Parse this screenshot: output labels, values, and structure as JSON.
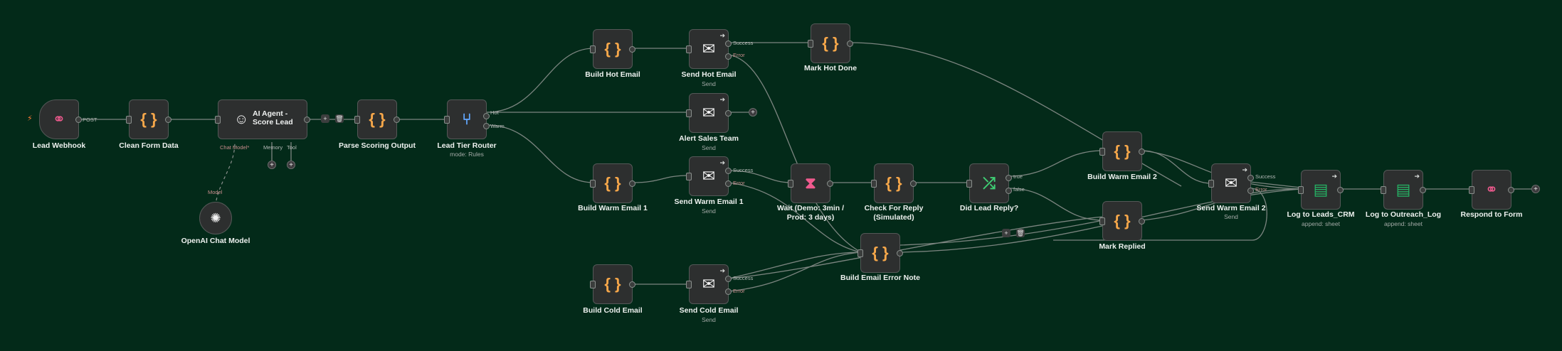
{
  "nodes": {
    "lead_webhook": {
      "label": "Lead Webhook",
      "icon": "webhook-icon",
      "port_label": "POST"
    },
    "clean_form_data": {
      "label": "Clean Form Data",
      "icon": "code-braces-icon"
    },
    "ai_agent": {
      "label": "AI Agent - Score Lead",
      "icon": "robot-icon",
      "port_chat_model": "Chat Model*",
      "port_memory": "Memory",
      "port_tool": "Tool"
    },
    "openai_chat_model": {
      "label": "OpenAI Chat Model",
      "icon": "openai-icon",
      "port_label": "Model"
    },
    "parse_scoring_output": {
      "label": "Parse Scoring Output",
      "icon": "code-braces-icon"
    },
    "lead_tier_router": {
      "label": "Lead Tier Router",
      "sub": "mode: Rules",
      "icon": "router-icon",
      "out_hot": "Hot",
      "out_warm": "Warm"
    },
    "build_hot_email": {
      "label": "Build Hot Email",
      "icon": "code-braces-icon"
    },
    "send_hot_email": {
      "label": "Send Hot Email",
      "sub": "Send",
      "icon": "mail-icon",
      "out_success": "Success",
      "out_error": "Error"
    },
    "mark_hot_done": {
      "label": "Mark Hot Done",
      "icon": "code-braces-icon"
    },
    "alert_sales_team": {
      "label": "Alert Sales Team",
      "sub": "Send",
      "icon": "mail-icon"
    },
    "build_warm_email_1": {
      "label": "Build Warm Email 1",
      "icon": "code-braces-icon"
    },
    "send_warm_email_1": {
      "label": "Send Warm Email 1",
      "sub": "Send",
      "icon": "mail-icon",
      "out_success": "Success",
      "out_error": "Error"
    },
    "wait": {
      "label": "Wait (Demo: 3min / Prod: 3 days)",
      "icon": "hourglass-icon"
    },
    "check_for_reply": {
      "label": "Check For Reply (Simulated)",
      "icon": "code-braces-icon"
    },
    "did_lead_reply": {
      "label": "Did Lead Reply?",
      "icon": "if-branch-icon",
      "out_true": "true",
      "out_false": "false"
    },
    "build_warm_email_2": {
      "label": "Build Warm Email 2",
      "icon": "code-braces-icon"
    },
    "mark_replied": {
      "label": "Mark Replied",
      "icon": "code-braces-icon"
    },
    "send_warm_email_2": {
      "label": "Send Warm Email 2",
      "sub": "Send",
      "icon": "mail-icon",
      "out_success": "Success",
      "out_error": "Error"
    },
    "build_email_error_note": {
      "label": "Build Email Error Note",
      "icon": "code-braces-icon"
    },
    "build_cold_email": {
      "label": "Build Cold Email",
      "icon": "code-braces-icon"
    },
    "send_cold_email": {
      "label": "Send Cold Email",
      "sub": "Send",
      "icon": "mail-icon",
      "out_success": "Success",
      "out_error": "Error"
    },
    "log_to_leads_crm": {
      "label": "Log to Leads_CRM",
      "sub": "append: sheet",
      "icon": "sheets-icon"
    },
    "log_to_outreach_log": {
      "label": "Log to Outreach_Log",
      "sub": "append: sheet",
      "icon": "sheets-icon"
    },
    "respond_to_form": {
      "label": "Respond to Form",
      "icon": "webhook-icon"
    }
  },
  "colors": {
    "canvas": "#032a19",
    "node_bg": "#2d2f2f",
    "edge": "#7c8580",
    "code_icon": "#f6a74a",
    "webhook_icon": "#ef5a8e",
    "router_icon": "#62a8ff",
    "if_icon": "#3fcf74",
    "sheets_icon": "#25b565",
    "trigger_bolt": "#ff7a36"
  }
}
